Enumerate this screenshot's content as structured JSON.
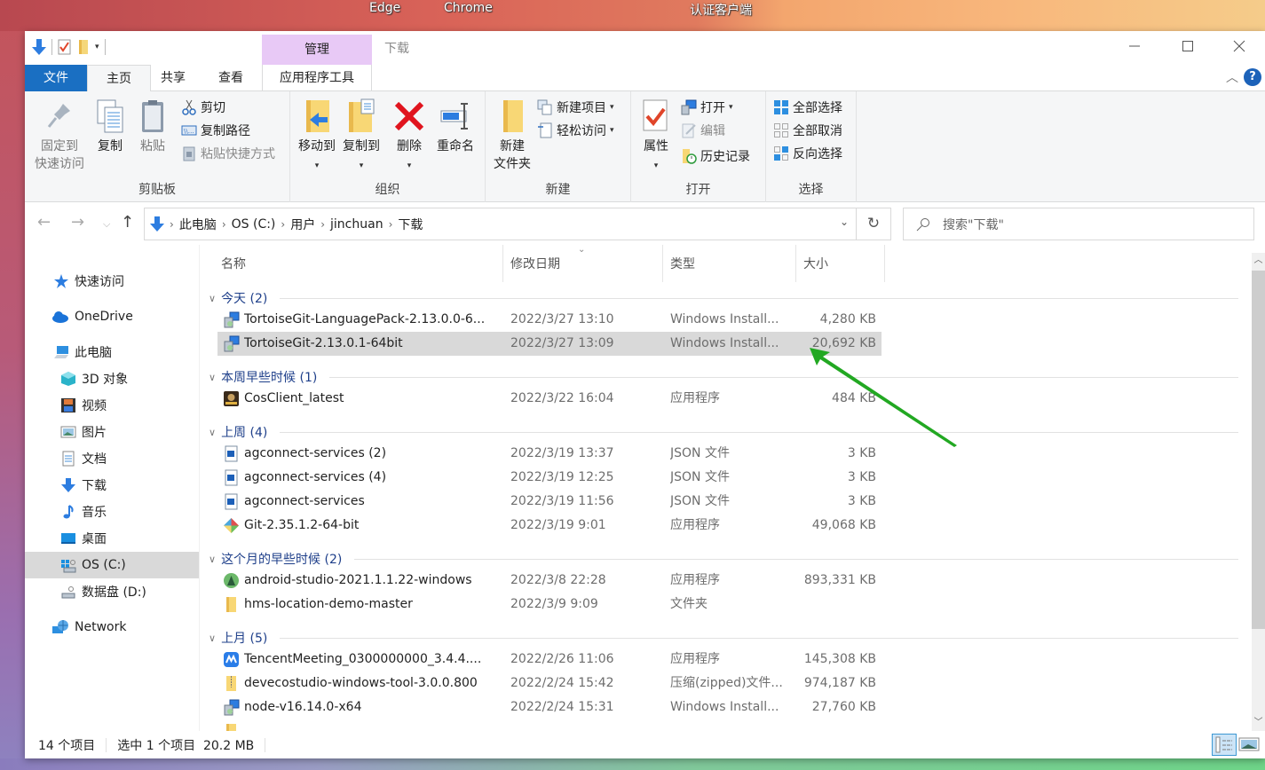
{
  "desktop": {
    "labels": [
      "Edge",
      "Chrome",
      "认证客户端"
    ]
  },
  "titlebar": {
    "context_tab_header": "管理",
    "window_title": "下载",
    "minimize_icon": "minimize-icon",
    "maximize_icon": "maximize-icon",
    "close_icon": "close-icon"
  },
  "ribbon_tabs": {
    "file": "文件",
    "home": "主页",
    "share": "共享",
    "view": "查看",
    "app_tools": "应用程序工具",
    "active": "主页"
  },
  "ribbon": {
    "clipboard": {
      "label": "剪贴板",
      "pin": "固定到\n快速访问",
      "pin_line1": "固定到",
      "pin_line2": "快速访问",
      "copy": "复制",
      "paste": "粘贴",
      "cut": "剪切",
      "copy_path": "复制路径",
      "paste_shortcut": "粘贴快捷方式"
    },
    "organize": {
      "label": "组织",
      "move_to": "移动到",
      "copy_to": "复制到",
      "delete": "删除",
      "rename": "重命名"
    },
    "new": {
      "label": "新建",
      "new_folder_line1": "新建",
      "new_folder_line2": "文件夹",
      "new_item": "新建项目",
      "easy_access": "轻松访问"
    },
    "open": {
      "label": "打开",
      "properties": "属性",
      "open": "打开",
      "edit": "编辑",
      "history": "历史记录"
    },
    "select": {
      "label": "选择",
      "select_all": "全部选择",
      "select_none": "全部取消",
      "invert": "反向选择"
    }
  },
  "address": {
    "breadcrumbs": [
      "此电脑",
      "OS (C:)",
      "用户",
      "jinchuan",
      "下载"
    ],
    "search_placeholder": "搜索\"下载\""
  },
  "nav_pane": {
    "items": [
      {
        "label": "快速访问",
        "icon": "star-icon"
      },
      {
        "label": "OneDrive",
        "icon": "cloud-icon"
      },
      {
        "label": "此电脑",
        "icon": "computer-icon"
      },
      {
        "label": "3D 对象",
        "icon": "cube-icon"
      },
      {
        "label": "视频",
        "icon": "video-icon"
      },
      {
        "label": "图片",
        "icon": "picture-icon"
      },
      {
        "label": "文档",
        "icon": "document-icon"
      },
      {
        "label": "下载",
        "icon": "download-icon"
      },
      {
        "label": "音乐",
        "icon": "music-icon"
      },
      {
        "label": "桌面",
        "icon": "desktop-icon"
      },
      {
        "label": "OS (C:)",
        "icon": "drive-c-icon",
        "selected": true
      },
      {
        "label": "数据盘 (D:)",
        "icon": "drive-d-icon"
      },
      {
        "label": "Network",
        "icon": "network-icon"
      }
    ]
  },
  "columns": {
    "name": "名称",
    "date": "修改日期",
    "type": "类型",
    "size": "大小"
  },
  "groups": [
    {
      "title": "今天 (2)",
      "files": [
        {
          "name": "TortoiseGit-LanguagePack-2.13.0.0-6...",
          "date": "2022/3/27 13:10",
          "type": "Windows Install...",
          "size": "4,280 KB",
          "icon": "installer-icon"
        },
        {
          "name": "TortoiseGit-2.13.0.1-64bit",
          "date": "2022/3/27 13:09",
          "type": "Windows Install...",
          "size": "20,692 KB",
          "icon": "installer-icon",
          "selected": true
        }
      ]
    },
    {
      "title": "本周早些时候 (1)",
      "files": [
        {
          "name": "CosClient_latest",
          "date": "2022/3/22 16:04",
          "type": "应用程序",
          "size": "484 KB",
          "icon": "app-icon"
        }
      ]
    },
    {
      "title": "上周 (4)",
      "files": [
        {
          "name": "agconnect-services (2)",
          "date": "2022/3/19 13:37",
          "type": "JSON 文件",
          "size": "3 KB",
          "icon": "json-file-icon"
        },
        {
          "name": "agconnect-services (4)",
          "date": "2022/3/19 12:25",
          "type": "JSON 文件",
          "size": "3 KB",
          "icon": "json-file-icon"
        },
        {
          "name": "agconnect-services",
          "date": "2022/3/19 11:56",
          "type": "JSON 文件",
          "size": "3 KB",
          "icon": "json-file-icon"
        },
        {
          "name": "Git-2.35.1.2-64-bit",
          "date": "2022/3/19 9:01",
          "type": "应用程序",
          "size": "49,068 KB",
          "icon": "git-icon"
        }
      ]
    },
    {
      "title": "这个月的早些时候 (2)",
      "files": [
        {
          "name": "android-studio-2021.1.1.22-windows",
          "date": "2022/3/8 22:28",
          "type": "应用程序",
          "size": "893,331 KB",
          "icon": "android-studio-icon"
        },
        {
          "name": "hms-location-demo-master",
          "date": "2022/3/9 9:09",
          "type": "文件夹",
          "size": "",
          "icon": "folder-icon"
        }
      ]
    },
    {
      "title": "上月 (5)",
      "files": [
        {
          "name": "TencentMeeting_0300000000_3.4.4....",
          "date": "2022/2/26 11:06",
          "type": "应用程序",
          "size": "145,308 KB",
          "icon": "tencent-meeting-icon"
        },
        {
          "name": "devecostudio-windows-tool-3.0.0.800",
          "date": "2022/2/24 15:42",
          "type": "压缩(zipped)文件...",
          "size": "974,187 KB",
          "icon": "zip-icon"
        },
        {
          "name": "node-v16.14.0-x64",
          "date": "2022/2/24 15:31",
          "type": "Windows Install...",
          "size": "27,760 KB",
          "icon": "installer-icon"
        }
      ]
    }
  ],
  "status": {
    "item_count": "14 个项目",
    "selection": "选中 1 个项目  20.2 MB"
  },
  "colors": {
    "accent": "#1a6fc2",
    "context_tab": "#e8c9f6",
    "selection": "#d9d9d9",
    "group_header": "#1e3f8a",
    "annotation_arrow": "#22a822"
  }
}
